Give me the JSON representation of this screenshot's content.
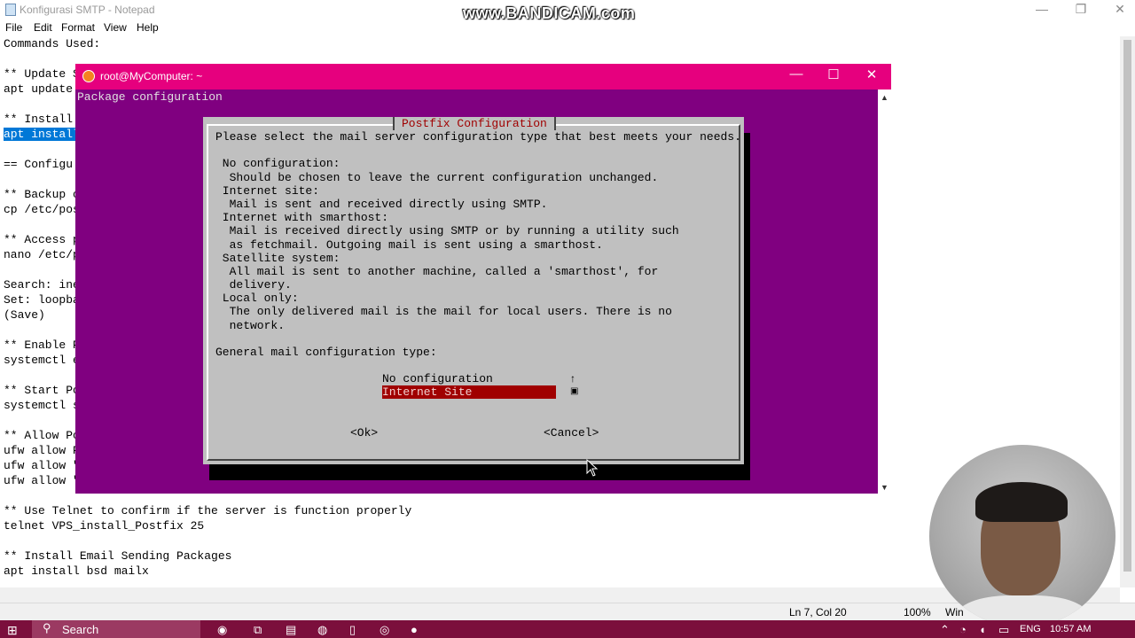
{
  "watermark": "www.BANDICAM.com",
  "notepad": {
    "title": "Konfigurasi SMTP - Notepad",
    "menu": [
      "File",
      "Edit",
      "Format",
      "View",
      "Help"
    ],
    "lines": [
      "Commands Used:",
      "",
      "** Update S",
      "apt update",
      "",
      "** Install",
      "apt install",
      "",
      "== Configu",
      "",
      "** Backup c",
      "cp /etc/pos",
      "",
      "** Access p",
      "nano /etc/p",
      "",
      "Search: ine",
      "Set: loopba",
      "(Save)",
      "",
      "** Enable P",
      "systemctl e",
      "",
      "** Start Po",
      "systemctl s",
      "",
      "** Allow Po",
      "ufw allow P",
      "ufw allow \"",
      "ufw allow \"",
      "",
      "** Use Telnet to confirm if the server is function properly",
      "telnet VPS_install_Postfix 25",
      "",
      "** Install Email Sending Packages",
      "apt install bsd mailx"
    ],
    "selected_line_index": 6,
    "status": {
      "position": "Ln 7, Col 20",
      "zoom": "100%",
      "encoding_partial": "Win"
    }
  },
  "terminal": {
    "title": "root@MyComputer: ~",
    "header": "Package configuration",
    "dialog": {
      "title": "Postfix Configuration",
      "lines": [
        "Please select the mail server configuration type that best meets your needs.",
        "",
        " No configuration:",
        "  Should be chosen to leave the current configuration unchanged.",
        " Internet site:",
        "  Mail is sent and received directly using SMTP.",
        " Internet with smarthost:",
        "  Mail is received directly using SMTP or by running a utility such",
        "  as fetchmail. Outgoing mail is sent using a smarthost.",
        " Satellite system:",
        "  All mail is sent to another machine, called a 'smarthost', for",
        "  delivery.",
        " Local only:",
        "  The only delivered mail is the mail for local users. There is no",
        "  network.",
        "",
        "General mail configuration type:"
      ],
      "options": [
        "No configuration",
        "Internet Site"
      ],
      "selected_option": "Internet Site",
      "ok_label": "<Ok>",
      "cancel_label": "<Cancel>"
    }
  },
  "taskbar": {
    "search_label": "Search",
    "language": "ENG",
    "time": "10:57 AM"
  },
  "colors": {
    "terminal_title_bar": "#e6007e",
    "terminal_background": "#800080",
    "dialog_background": "#c0c0c0",
    "selection_red": "#a00000",
    "taskbar": "#7b0f3c"
  }
}
